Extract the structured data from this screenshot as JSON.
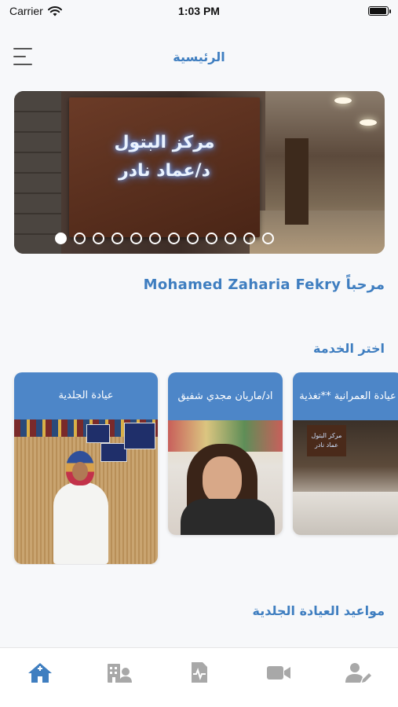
{
  "status_bar": {
    "carrier": "Carrier",
    "time": "1:03 PM",
    "battery_level": 0.95
  },
  "header": {
    "title": "الرئيسية"
  },
  "slider": {
    "sign_line1": "مركز البتول",
    "sign_line2": "د/عماد نادر",
    "card3_sign": "مركز البتول عماد نادر",
    "dot_count": 12,
    "active_index": 0
  },
  "welcome": {
    "text": "مرحباً Mohamed Zaharia Fekry"
  },
  "services": {
    "title": "اختر الخدمة",
    "items": [
      {
        "label": "عيادة الجلدية"
      },
      {
        "label": "ا‏د/ماريان مجدي شفيق"
      },
      {
        "label": "عيادة العمرانية **تغذية"
      }
    ]
  },
  "appointments": {
    "title": "مواعيد العيادة الجلدية"
  },
  "tabs": [
    {
      "name": "home-icon",
      "active": true
    },
    {
      "name": "clinic-doctor-icon",
      "active": false
    },
    {
      "name": "medical-report-icon",
      "active": false
    },
    {
      "name": "video-camera-icon",
      "active": false
    },
    {
      "name": "user-edit-icon",
      "active": false
    }
  ],
  "colors": {
    "accent": "#3f7ec0",
    "card_header": "#4d86c8",
    "tab_active": "#3f7ec0",
    "tab_inactive": "#a8a8a8"
  }
}
